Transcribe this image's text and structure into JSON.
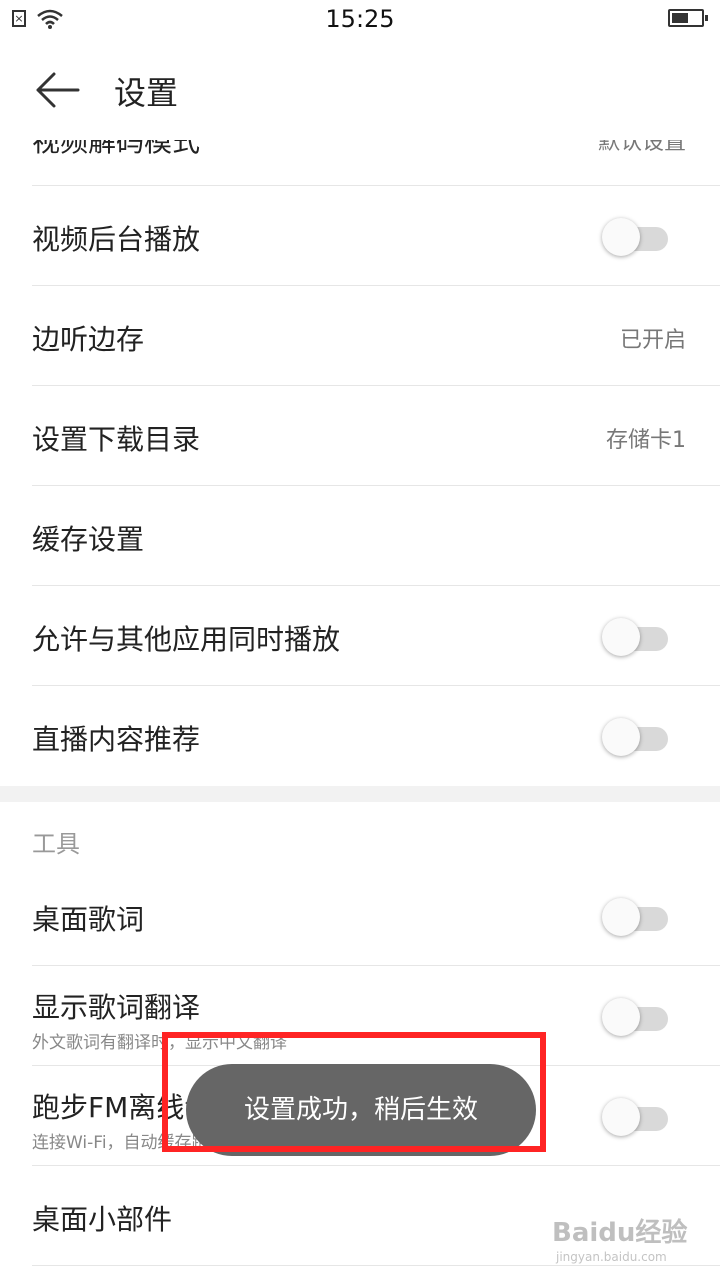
{
  "status_bar": {
    "time": "15:25",
    "sim_glyph": "×"
  },
  "header": {
    "title": "设置"
  },
  "list_top": [
    {
      "label": "视频解码模式",
      "value": "默认设置"
    },
    {
      "label": "视频后台播放",
      "toggle": "off"
    },
    {
      "label": "边听边存",
      "value": "已开启"
    },
    {
      "label": "设置下载目录",
      "value": "存储卡1"
    },
    {
      "label": "缓存设置"
    },
    {
      "label": "允许与其他应用同时播放",
      "toggle": "off"
    },
    {
      "label": "直播内容推荐",
      "toggle": "off"
    }
  ],
  "tools_section": {
    "title": "工具",
    "items": [
      {
        "label": "桌面歌词",
        "toggle": "off"
      },
      {
        "label": "显示歌词翻译",
        "sub": "外文歌词有翻译时，显示中文翻译",
        "toggle": "off"
      },
      {
        "label": "跑步FM离线包",
        "sub": "连接Wi-Fi，自动缓存跑步歌曲",
        "toggle": "off"
      },
      {
        "label": "桌面小部件"
      }
    ]
  },
  "toast": {
    "message": "设置成功，稍后生效"
  },
  "watermark": {
    "brand": "Baidu经验",
    "url": "jingyan.baidu.com"
  },
  "colors": {
    "highlight": "#ff2424",
    "toast_bg": "#666666",
    "toggle_track": "#d9d9d9"
  }
}
